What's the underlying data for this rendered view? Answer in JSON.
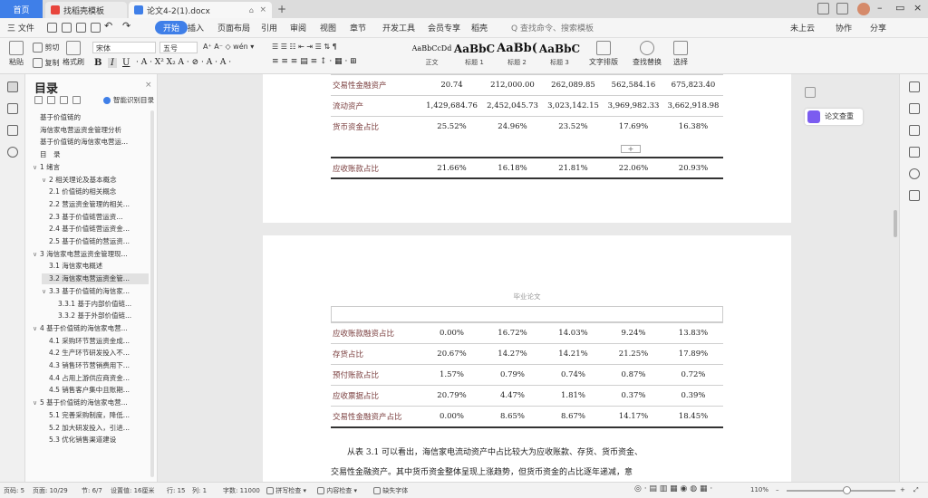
{
  "titlebar": {
    "home_tab": "首页",
    "tab_a": "找稻壳模板",
    "tab_b": "论文4-2(1).docx",
    "new_tab": "+"
  },
  "menu": {
    "file": "三 文件",
    "items": [
      "开始",
      "插入",
      "页面布局",
      "引用",
      "审阅",
      "视图",
      "章节",
      "开发工具",
      "会员专享",
      "稻壳"
    ],
    "active": "开始",
    "search_placeholder": "Q 查找命令、搜索模板",
    "cloud": "未上云",
    "collab": "协作",
    "share": "分享"
  },
  "ribbon": {
    "paste": "粘贴",
    "cut": "剪切",
    "copy": "复制",
    "format_painter": "格式刷",
    "font_name": "宋体",
    "font_size": "五号",
    "styles": [
      {
        "preview": "AaBbCcDd",
        "name": "正文"
      },
      {
        "preview": "AaBbC",
        "name": "标题 1"
      },
      {
        "preview": "AaBb(",
        "name": "标题 2"
      },
      {
        "preview": "AaBbC",
        "name": "标题 3"
      }
    ],
    "text_layout": "文字排版",
    "find_replace": "查找替换",
    "select": "选择"
  },
  "toc": {
    "title": "目录",
    "close": "×",
    "smart": "智能识别目录",
    "items": [
      {
        "text": "基于价值链的",
        "indent": 0,
        "caret": ""
      },
      {
        "text": "海信家电营运资金管理分析",
        "indent": 0,
        "caret": ""
      },
      {
        "text": "基于价值链的海信家电营运...",
        "indent": 0,
        "caret": ""
      },
      {
        "text": "目　录",
        "indent": 0,
        "caret": ""
      },
      {
        "text": "1 绪言",
        "indent": 0,
        "caret": "∨"
      },
      {
        "text": "2 相关理论及基本概念",
        "indent": 1,
        "caret": "∨"
      },
      {
        "text": "2.1 价值链的相关概念",
        "indent": 1,
        "caret": ""
      },
      {
        "text": "2.2 营运资金管理的相关...",
        "indent": 1,
        "caret": ""
      },
      {
        "text": "2.3 基于价值链营运资...",
        "indent": 1,
        "caret": ""
      },
      {
        "text": "2.4 基于价值链营运资金...",
        "indent": 1,
        "caret": ""
      },
      {
        "text": "2.5 基于价值链的营运资...",
        "indent": 1,
        "caret": ""
      },
      {
        "text": "3 海信家电营运资金管理现...",
        "indent": 0,
        "caret": "∨"
      },
      {
        "text": "3.1 海信家电概述",
        "indent": 1,
        "caret": ""
      },
      {
        "text": "3.2 海信家电营运资金管...",
        "indent": 1,
        "caret": "",
        "highlight": true
      },
      {
        "text": "3.3 基于价值链的海信家...",
        "indent": 1,
        "caret": "∨"
      },
      {
        "text": "3.3.1 基于内部价值链...",
        "indent": 2,
        "caret": ""
      },
      {
        "text": "3.3.2 基于外部价值链...",
        "indent": 2,
        "caret": ""
      },
      {
        "text": "4 基于价值链的海信家电营...",
        "indent": 0,
        "caret": "∨"
      },
      {
        "text": "4.1 采购环节营运资金成...",
        "indent": 1,
        "caret": ""
      },
      {
        "text": "4.2 生产环节研发投入不...",
        "indent": 1,
        "caret": ""
      },
      {
        "text": "4.3 销售环节营销费用下...",
        "indent": 1,
        "caret": ""
      },
      {
        "text": "4.4 占用上游供应商资金...",
        "indent": 1,
        "caret": ""
      },
      {
        "text": "4.5 销售客户集中且账期...",
        "indent": 1,
        "caret": ""
      },
      {
        "text": "5 基于价值链的海信家电营...",
        "indent": 0,
        "caret": "∨"
      },
      {
        "text": "5.1 完善采购制度，降低...",
        "indent": 1,
        "caret": ""
      },
      {
        "text": "5.2 加大研发投入，引进...",
        "indent": 1,
        "caret": ""
      },
      {
        "text": "5.3 优化销售渠道建设",
        "indent": 1,
        "caret": ""
      }
    ]
  },
  "doc": {
    "table1": [
      [
        "交易性金融资产",
        "20.74",
        "212,000.00",
        "262,089.85",
        "562,584.16",
        "675,823.40"
      ],
      [
        "流动资产",
        "1,429,684.76",
        "2,452,045.73",
        "3,023,142.15",
        "3,969,982.33",
        "3,662,918.98"
      ],
      [
        "货币资金占比",
        "25.52%",
        "24.96%",
        "23.52%",
        "17.69%",
        "16.38%"
      ]
    ],
    "table1b": [
      [
        "应收账款占比",
        "21.66%",
        "16.18%",
        "21.81%",
        "22.06%",
        "20.93%"
      ]
    ],
    "page_header": "毕业论文",
    "table2": [
      [
        "应收账款融资占比",
        "0.00%",
        "16.72%",
        "14.03%",
        "9.24%",
        "13.83%"
      ],
      [
        "存货占比",
        "20.67%",
        "14.27%",
        "14.21%",
        "21.25%",
        "17.89%"
      ],
      [
        "预付账款占比",
        "1.57%",
        "0.79%",
        "0.74%",
        "0.87%",
        "0.72%"
      ],
      [
        "应收票据占比",
        "20.79%",
        "4.47%",
        "1.81%",
        "0.37%",
        "0.39%"
      ],
      [
        "交易性金融资产占比",
        "0.00%",
        "8.65%",
        "8.67%",
        "14.17%",
        "18.45%"
      ]
    ],
    "para1": "从表 3.1 可以看出，海信家电流动资产中占比较大为应收账款、存货、货币资金、",
    "para2": "交易性金融资产。其中货币资金整体呈现上涨趋势，但货币资金的占比逐年递减，意"
  },
  "rightpanel": {
    "paper_check": "论文查重"
  },
  "status": {
    "page": "页码: 5",
    "pages": "页面: 10/29",
    "section": "节: 6/7",
    "setting": "设置值: 16厘米",
    "row": "行: 15",
    "col": "列: 1",
    "words": "字数: 11000",
    "spell": "拼写检查",
    "content_check": "内容检查",
    "missing_font": "缺失字体",
    "zoom": "110%"
  }
}
